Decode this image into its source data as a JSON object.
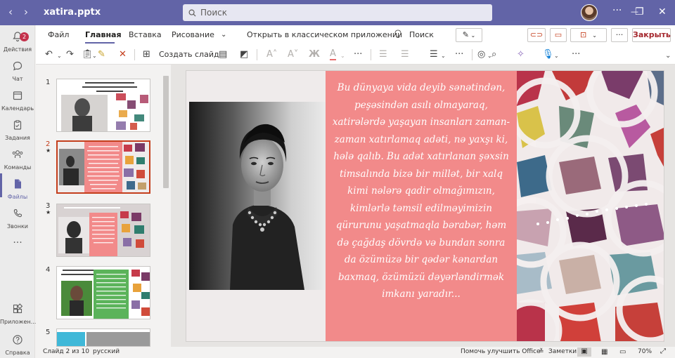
{
  "titlebar": {
    "back": "‹",
    "forward": "›",
    "file_name": "xatira.pptx",
    "search_placeholder": "Поиск",
    "more": "···",
    "minimize": "—",
    "restore": "❐",
    "close": "✕"
  },
  "rail": {
    "activity": {
      "label": "Действия",
      "badge": "2"
    },
    "chat": "Чат",
    "calendar": "Календарь",
    "tasks": "Задания",
    "teams": "Команды",
    "files": "Файлы",
    "calls": "Звонки",
    "more": "···",
    "apps": "Приложен...",
    "help": "Справка"
  },
  "menu": {
    "file": "Файл",
    "home": "Главная",
    "insert": "Вставка",
    "draw": "Рисование",
    "open_desktop": "Открыть в классическом приложении",
    "tell_me": "Поиск",
    "close": "Закрыть"
  },
  "ribbon": {
    "new_slide": "Создать слайд"
  },
  "thumbnails": [
    {
      "number": "1",
      "star": ""
    },
    {
      "number": "2",
      "star": "★"
    },
    {
      "number": "3",
      "star": "★"
    },
    {
      "number": "4",
      "star": ""
    },
    {
      "number": "5",
      "star": ""
    }
  ],
  "slide": {
    "text": "Bu dünyaya vida deyib sənətindən, peşəsindən asılı olmayaraq, xatirələrdə yaşayan insanları zaman-zaman xatırlamaq adəti, nə yaxşı ki, hələ qalıb. Bu adət xatırlanan şəxsin timsalında bizə bir millət, bir xalq kimi nələrə qadir olmağımızın, kimlərlə təmsil edilməyimizin qürurunu yaşatmaqla bərabər, həm də çağdaş dövrdə və bundan sonra da özümüzə bir qədər kənardan baxmaq, özümüzü dəyərləndirmək imkanı yaradır..."
  },
  "status": {
    "slide_of": "Слайд 2 из 10",
    "language": "русский",
    "feedback": "Помочь улучшить Office",
    "notes": "Заметки",
    "zoom": "70%"
  },
  "colors": {
    "accent": "#6264a7",
    "slide_text_bg": "#f28a8a",
    "selection": "#c43e1c"
  }
}
